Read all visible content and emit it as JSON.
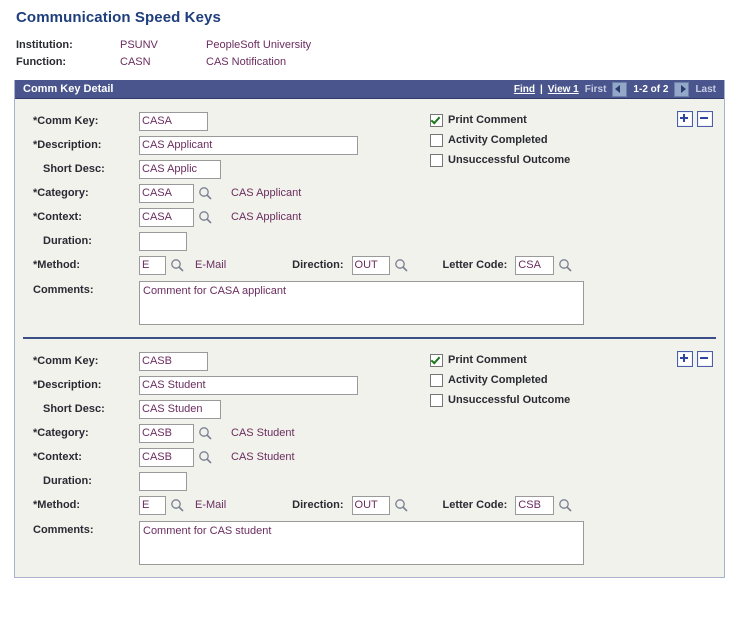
{
  "page": {
    "title": "Communication Speed Keys"
  },
  "keyfields": [
    {
      "label": "Institution:",
      "code": "PSUNV",
      "description": "PeopleSoft University"
    },
    {
      "label": "Function:",
      "code": "CASN",
      "description": "CAS Notification"
    }
  ],
  "groupbox": {
    "title": "Comm Key Detail",
    "nav": {
      "find_label": "Find",
      "separator": "|",
      "view_label": "View 1",
      "first_label": "First",
      "prev_icon": "left-arrow-icon",
      "counter": "1-2 of 2",
      "next_icon": "right-arrow-icon",
      "last_label": "Last"
    }
  },
  "labels": {
    "comm_key": "*Comm Key:",
    "description": "*Description:",
    "short_desc": "Short Desc:",
    "category": "*Category:",
    "context": "*Context:",
    "duration": "Duration:",
    "method": "*Method:",
    "direction": "Direction:",
    "letter_code": "Letter Code:",
    "comments": "Comments:"
  },
  "checkbox_labels": {
    "print_comment": "Print Comment",
    "activity_completed": "Activity Completed",
    "unsuccessful_outcome": "Unsuccessful Outcome"
  },
  "buttons": {
    "add_row": "+",
    "delete_row": "-"
  },
  "rows": [
    {
      "comm_key": "CASA",
      "description": "CAS Applicant",
      "short_desc": "CAS Applic",
      "category": "CASA",
      "category_xlat": "CAS Applicant",
      "context": "CASA",
      "context_xlat": "CAS Applicant",
      "duration": "",
      "method": "E",
      "method_xlat": "E-Mail",
      "direction": "OUT",
      "letter_code": "CSA",
      "comments": "Comment for CASA applicant",
      "print_comment": true,
      "activity_completed": false,
      "unsuccessful_outcome": false
    },
    {
      "comm_key": "CASB",
      "description": "CAS Student",
      "short_desc": "CAS Studen",
      "category": "CASB",
      "category_xlat": "CAS Student",
      "context": "CASB",
      "context_xlat": "CAS Student",
      "duration": "",
      "method": "E",
      "method_xlat": "E-Mail",
      "direction": "OUT",
      "letter_code": "CSB",
      "comments": "Comment for CAS student",
      "print_comment": true,
      "activity_completed": false,
      "unsuccessful_outcome": false
    }
  ],
  "colors": {
    "title": "#1f3e7c",
    "header_bar": "#49558c",
    "field_text": "#6b2c5f",
    "label_text": "#2a2a33",
    "panel_bg": "#f1f2ec",
    "check_green": "#1a7a1a",
    "button_blue": "#2e46a0"
  }
}
